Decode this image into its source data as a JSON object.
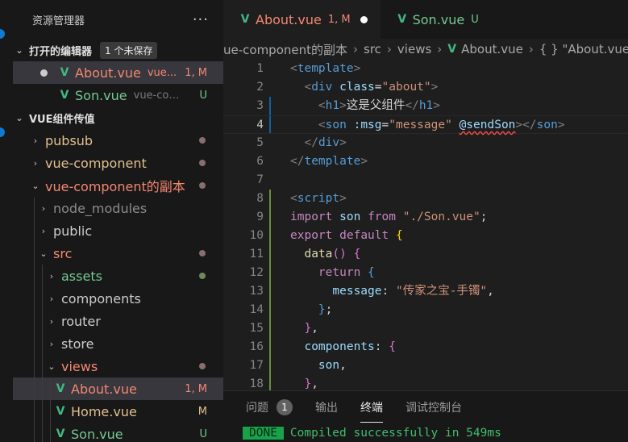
{
  "colors": {
    "vue_green": "#41b883",
    "modified": "#e2c08d",
    "error_red": "#f48771",
    "untracked": "#73c991",
    "done_bg": "#16a34a"
  },
  "sidebar": {
    "title": "资源管理器",
    "more": "···",
    "open_editors": {
      "label": "打开的编辑器",
      "unsaved_badge": "1 个未保存",
      "items": [
        {
          "name": "About.vue",
          "desc": "vue...",
          "status": "1, M"
        },
        {
          "name": "Son.vue",
          "desc": "vue-com...",
          "status": "U"
        }
      ]
    },
    "workspace": {
      "label": "VUE组件传值",
      "tree": [
        {
          "name": "pubsub"
        },
        {
          "name": "vue-component"
        },
        {
          "name": "vue-component的副本"
        },
        {
          "name": "node_modules"
        },
        {
          "name": "public"
        },
        {
          "name": "src"
        },
        {
          "name": "assets"
        },
        {
          "name": "components"
        },
        {
          "name": "router"
        },
        {
          "name": "store"
        },
        {
          "name": "views"
        },
        {
          "name": "About.vue",
          "status": "1, M"
        },
        {
          "name": "Home.vue",
          "status": "M"
        },
        {
          "name": "Son.vue",
          "status": "U"
        }
      ]
    }
  },
  "tabs": [
    {
      "name": "About.vue",
      "status": "1, M"
    },
    {
      "name": "Son.vue",
      "status": "U"
    }
  ],
  "breadcrumb": [
    "ue-component的副本",
    "src",
    "views",
    "About.vue",
    "{ } \"About.vue\""
  ],
  "editor": {
    "lines": [
      "1",
      "2",
      "3",
      "4",
      "5",
      "6",
      "7",
      "8",
      "9",
      "10",
      "11",
      "12",
      "13",
      "14",
      "15",
      "16",
      "17",
      "18"
    ]
  },
  "panel": {
    "tabs": [
      {
        "label": "问题",
        "count": "1"
      },
      {
        "label": "输出"
      },
      {
        "label": "终端"
      },
      {
        "label": "调试控制台"
      }
    ],
    "terminal": {
      "badge": "DONE",
      "message": "Compiled successfully in 549ms"
    }
  }
}
